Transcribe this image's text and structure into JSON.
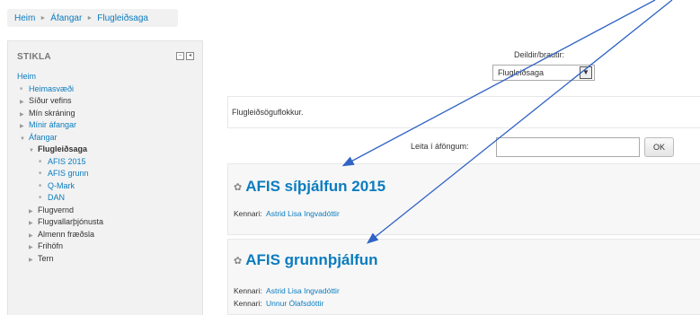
{
  "breadcrumb": [
    "Heim",
    "Áfangar",
    "Flugleiðsaga"
  ],
  "nav_block": {
    "title": "STIKLA",
    "items": [
      {
        "label": "Heim",
        "level": 0,
        "type": "home"
      },
      {
        "label": "Heimasvæði",
        "level": 1,
        "type": "leaf-link"
      },
      {
        "label": "Síður vefins",
        "level": 1,
        "type": "collapsed"
      },
      {
        "label": "Mín skráning",
        "level": 1,
        "type": "collapsed"
      },
      {
        "label": "Mínir áfangar",
        "level": 1,
        "type": "collapsed-link"
      },
      {
        "label": "Áfangar",
        "level": 1,
        "type": "expanded-link"
      },
      {
        "label": "Flugleiðsaga",
        "level": 2,
        "type": "expanded-bold"
      },
      {
        "label": "AFIS 2015",
        "level": 3,
        "type": "leaf-link"
      },
      {
        "label": "AFIS grunn",
        "level": 3,
        "type": "leaf-link"
      },
      {
        "label": "Q-Mark",
        "level": 3,
        "type": "leaf-link"
      },
      {
        "label": "DAN",
        "level": 3,
        "type": "leaf-link"
      },
      {
        "label": "Flugvernd",
        "level": 2,
        "type": "collapsed"
      },
      {
        "label": "Flugvallarþjónusta",
        "level": 2,
        "type": "collapsed"
      },
      {
        "label": "Almenn fræðsla",
        "level": 2,
        "type": "collapsed"
      },
      {
        "label": "Frihöfn",
        "level": 2,
        "type": "collapsed"
      },
      {
        "label": "Tern",
        "level": 2,
        "type": "collapsed"
      }
    ]
  },
  "department": {
    "label": "Deildir/brautir:",
    "selected": "Flugleiðsaga"
  },
  "category_description": "Flugleiðsöguflokkur.",
  "search": {
    "label": "Leita í áföngum:",
    "value": "",
    "button": "OK"
  },
  "courses": [
    {
      "title": "AFIS síþjálfun 2015",
      "teachers": [
        {
          "role": "Kennari:",
          "name": "Astrid Lisa Ingvadóttir"
        }
      ]
    },
    {
      "title": "AFIS grunnþjálfun",
      "teachers": [
        {
          "role": "Kennari:",
          "name": "Astrid Lisa Ingvadóttir"
        },
        {
          "role": "Kennari:",
          "name": "Unnur Ólafsdóttir"
        }
      ]
    }
  ],
  "colors": {
    "link": "#0a7cbf",
    "annotation_arrow": "#2f63c4"
  }
}
